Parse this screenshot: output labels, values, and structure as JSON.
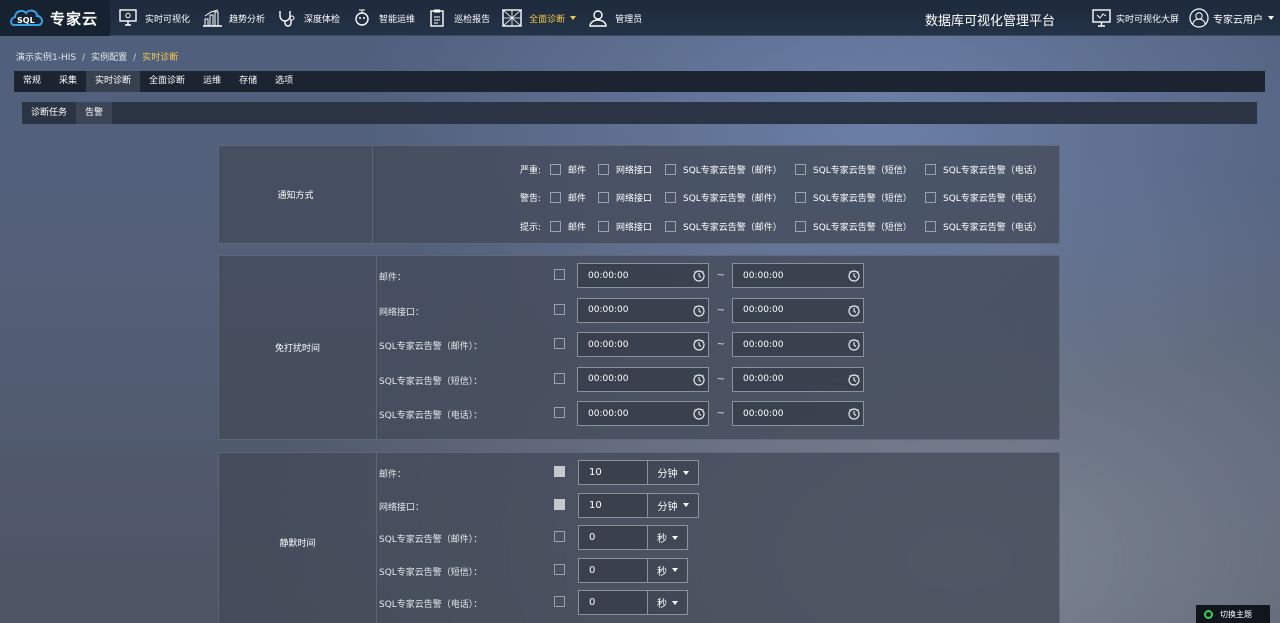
{
  "logo": {
    "text": "专家云",
    "mark": "SQL"
  },
  "nav": [
    {
      "label": "实时可视化",
      "icon": "monitor-icon"
    },
    {
      "label": "趋势分析",
      "icon": "bar-chart-icon"
    },
    {
      "label": "深度体检",
      "icon": "stethoscope-icon"
    },
    {
      "label": "智能运维",
      "icon": "robot-icon"
    },
    {
      "label": "巡检报告",
      "icon": "clipboard-icon"
    },
    {
      "label": "全面诊断",
      "icon": "grid-icon",
      "active": true
    },
    {
      "label": "管理员",
      "icon": "user-icon"
    }
  ],
  "platform_title": "数据库可视化管理平台",
  "top_right": {
    "screen_label": "实时可视化大屏",
    "user_label": "专家云用户"
  },
  "breadcrumb": [
    "演示实例1-HIS",
    "实例配置",
    "实时诊断"
  ],
  "tabs_primary": [
    "常规",
    "采集",
    "实时诊断",
    "全面诊断",
    "运维",
    "存储",
    "选项"
  ],
  "tabs_primary_active": "实时诊断",
  "tabs_secondary": [
    "诊断任务",
    "告警"
  ],
  "tabs_secondary_active": "告警",
  "notify": {
    "title": "通知方式",
    "channels": [
      "邮件",
      "网络接口",
      "SQL专家云告警（邮件）",
      "SQL专家云告警（短信）",
      "SQL专家云告警（电话）"
    ],
    "levels": [
      "严重:",
      "警告:",
      "提示:"
    ]
  },
  "quiet": {
    "title": "免打扰时间",
    "rows": [
      {
        "label": "邮件：",
        "start": "00:00:00",
        "end": "00:00:00"
      },
      {
        "label": "网络接口：",
        "start": "00:00:00",
        "end": "00:00:00"
      },
      {
        "label": "SQL专家云告警（邮件）：",
        "start": "00:00:00",
        "end": "00:00:00"
      },
      {
        "label": "SQL专家云告警（短信）：",
        "start": "00:00:00",
        "end": "00:00:00"
      },
      {
        "label": "SQL专家云告警（电话）：",
        "start": "00:00:00",
        "end": "00:00:00"
      }
    ],
    "tilde": "~"
  },
  "silence": {
    "title": "静默时间",
    "rows": [
      {
        "label": "邮件：",
        "value": "10",
        "unit": "分钟",
        "checked": true
      },
      {
        "label": "网络接口：",
        "value": "10",
        "unit": "分钟",
        "checked": true
      },
      {
        "label": "SQL专家云告警（邮件）：",
        "value": "0",
        "unit": "秒",
        "checked": false
      },
      {
        "label": "SQL专家云告警（短信）：",
        "value": "0",
        "unit": "秒",
        "checked": false
      },
      {
        "label": "SQL专家云告警（电话）：",
        "value": "0",
        "unit": "秒",
        "checked": false
      }
    ]
  },
  "theme_toggle": "切换主题",
  "colors": {
    "accent": "#f2c94c",
    "toggle": "#39d353"
  }
}
